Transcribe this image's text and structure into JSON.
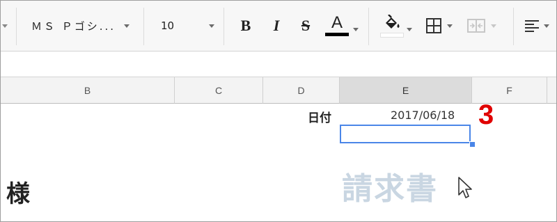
{
  "toolbar": {
    "font_family": "ＭＳ Ｐゴシ...",
    "font_size": "10",
    "bold_label": "B",
    "italic_label": "I",
    "strike_label": "S",
    "text_color_label": "A",
    "icons": [
      "text-color-icon",
      "fill-color-icon",
      "borders-icon",
      "merge-cells-icon",
      "align-left-icon"
    ],
    "colors": {
      "text_color_bar": "#000000",
      "fill_color_bar": "#ffffff"
    }
  },
  "columns": [
    "B",
    "C",
    "D",
    "E",
    "F"
  ],
  "selected_column": "E",
  "cells": {
    "d_label": "日付",
    "e_date": "2017/06/18",
    "customer_suffix": "様",
    "invoice_title": "請求書"
  },
  "annotation": {
    "step_number": "3",
    "color": "#e00000"
  }
}
